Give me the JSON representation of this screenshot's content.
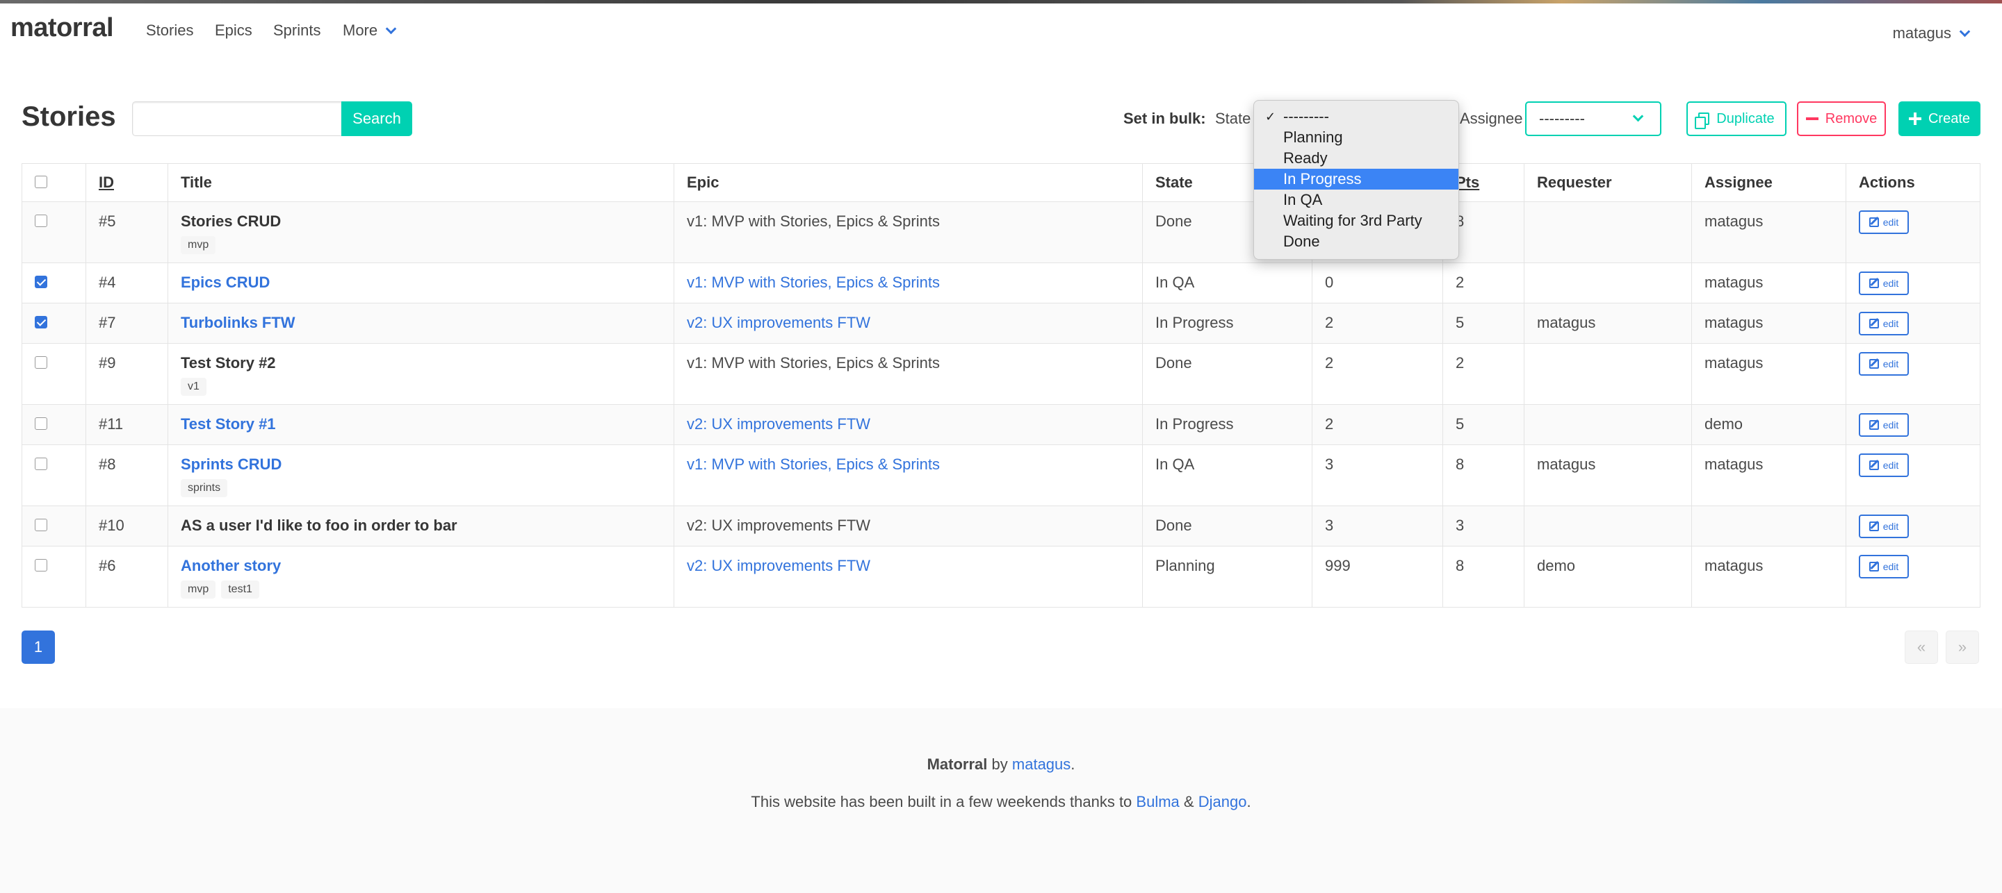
{
  "navbar": {
    "brand": "matorral",
    "items": [
      "Stories",
      "Epics",
      "Sprints",
      "More"
    ],
    "user": "matagus"
  },
  "toolbar": {
    "title": "Stories",
    "search_value": "",
    "search_button": "Search",
    "bulk_label": "Set in bulk:",
    "state_label": "State",
    "assignee_label": "Assignee",
    "assignee_value": "---------",
    "duplicate_label": "Duplicate",
    "remove_label": "Remove",
    "create_label": "Create"
  },
  "state_dropdown": {
    "options": [
      "---------",
      "Planning",
      "Ready",
      "In Progress",
      "In QA",
      "Waiting for 3rd Party",
      "Done"
    ],
    "selected": "---------",
    "highlighted": "In Progress"
  },
  "table": {
    "headers": [
      "ID",
      "Title",
      "Epic",
      "State",
      "",
      "Pts",
      "Requester",
      "Assignee",
      "Actions"
    ],
    "rows": [
      {
        "id": "#5",
        "title": "Stories CRUD",
        "title_link": false,
        "tags": [
          "mvp"
        ],
        "epic": "v1: MVP with Stories, Epics & Sprints",
        "epic_link": false,
        "state": "Done",
        "priority": "",
        "pts": "8",
        "requester": "",
        "assignee": "matagus",
        "checked": false,
        "action": "edit"
      },
      {
        "id": "#4",
        "title": "Epics CRUD",
        "title_link": true,
        "tags": [],
        "epic": "v1: MVP with Stories, Epics & Sprints",
        "epic_link": true,
        "state": "In QA",
        "priority": "0",
        "pts": "2",
        "requester": "",
        "assignee": "matagus",
        "checked": true,
        "action": "edit"
      },
      {
        "id": "#7",
        "title": "Turbolinks FTW",
        "title_link": true,
        "tags": [],
        "epic": "v2: UX improvements FTW",
        "epic_link": true,
        "state": "In Progress",
        "priority": "2",
        "pts": "5",
        "requester": "matagus",
        "assignee": "matagus",
        "checked": true,
        "action": "edit"
      },
      {
        "id": "#9",
        "title": "Test Story #2",
        "title_link": false,
        "tags": [
          "v1"
        ],
        "epic": "v1: MVP with Stories, Epics & Sprints",
        "epic_link": false,
        "state": "Done",
        "priority": "2",
        "pts": "2",
        "requester": "",
        "assignee": "matagus",
        "checked": false,
        "action": "edit"
      },
      {
        "id": "#11",
        "title": "Test Story #1",
        "title_link": true,
        "tags": [],
        "epic": "v2: UX improvements FTW",
        "epic_link": true,
        "state": "In Progress",
        "priority": "2",
        "pts": "5",
        "requester": "",
        "assignee": "demo",
        "checked": false,
        "action": "edit"
      },
      {
        "id": "#8",
        "title": "Sprints CRUD",
        "title_link": true,
        "tags": [
          "sprints"
        ],
        "epic": "v1: MVP with Stories, Epics & Sprints",
        "epic_link": true,
        "state": "In QA",
        "priority": "3",
        "pts": "8",
        "requester": "matagus",
        "assignee": "matagus",
        "checked": false,
        "action": "edit"
      },
      {
        "id": "#10",
        "title": "AS a user I'd like to foo in order to bar",
        "title_link": false,
        "tags": [],
        "epic": "v2: UX improvements FTW",
        "epic_link": false,
        "state": "Done",
        "priority": "3",
        "pts": "3",
        "requester": "",
        "assignee": "",
        "checked": false,
        "action": "edit"
      },
      {
        "id": "#6",
        "title": "Another story",
        "title_link": true,
        "tags": [
          "mvp",
          "test1"
        ],
        "epic": "v2: UX improvements FTW",
        "epic_link": true,
        "state": "Planning",
        "priority": "999",
        "pts": "8",
        "requester": "demo",
        "assignee": "matagus",
        "checked": false,
        "action": "edit"
      }
    ]
  },
  "pagination": {
    "current": "1",
    "prev": "«",
    "next": "»"
  },
  "footer": {
    "app_name": "Matorral",
    "by": "by",
    "author": "matagus",
    "line2_prefix": "This website has been built in a few weekends thanks to",
    "link1": "Bulma",
    "amp": "&",
    "link2": "Django",
    "period": "."
  },
  "colors": {
    "primary": "#00d1b2",
    "link": "#3273dc",
    "danger": "#ff3860",
    "highlight": "#3b84f5"
  }
}
